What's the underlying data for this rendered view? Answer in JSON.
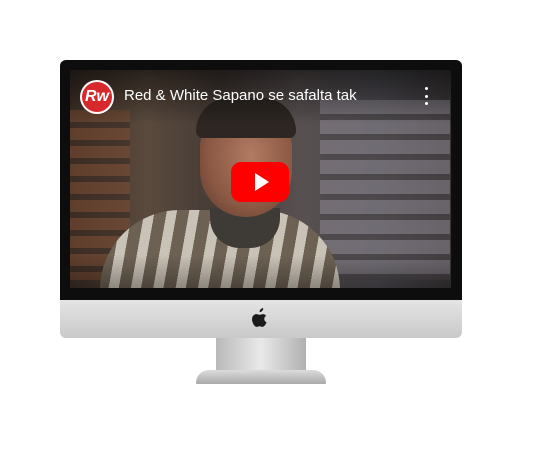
{
  "video": {
    "title": "Red & White Sapano se safalta tak",
    "channel_logo_text": "Rw",
    "play_icon": "play-icon",
    "more_icon": "more-vertical-icon"
  },
  "colors": {
    "play_button": "#ff0000",
    "channel_logo": "#d7282c"
  }
}
